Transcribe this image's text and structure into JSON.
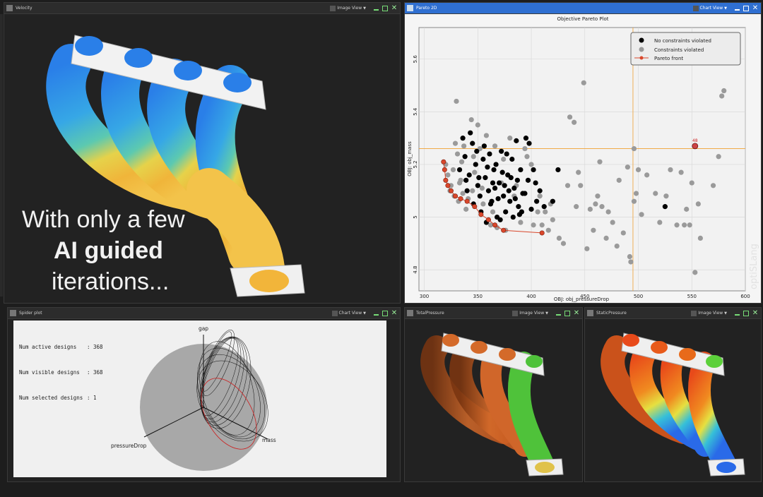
{
  "panels": {
    "velocity": {
      "title": "Velocity",
      "view": "Image View"
    },
    "pareto": {
      "title": "Pareto 2D",
      "view": "Chart View"
    },
    "spider": {
      "title": "Spider plot",
      "view": "Chart View"
    },
    "total_pressure": {
      "title": "TotalPressure",
      "view": "Image View"
    },
    "static_pressure": {
      "title": "StaticPressure",
      "view": "Image View"
    }
  },
  "overlay_text": {
    "line1": "With only a few",
    "line2": "AI guided",
    "line3": "iterations..."
  },
  "spider_info": {
    "active_label": "Num active designs",
    "active_value": ": 368",
    "visible_label": "Num visible designs",
    "visible_value": ": 368",
    "selected_label": "Num selected designs",
    "selected_value": ": 1"
  },
  "spider_axes": {
    "top": "gap",
    "left": "pressureDrop",
    "right": "mass"
  },
  "watermark": "optiSLang",
  "colors": {
    "accent": "#2f6fd1",
    "pareto": "#d9472b",
    "crosshair": "#f0a030"
  },
  "chart_data": {
    "type": "scatter",
    "title": "Objective Pareto Plot",
    "xlabel": "OBJ: obj_pressureDrop",
    "ylabel": "OBJ: obj_mass",
    "xlim": [
      295,
      600
    ],
    "ylim": [
      4.72,
      5.72
    ],
    "xticks": [
      "300",
      "350",
      "400",
      "450",
      "500",
      "550",
      "600"
    ],
    "yticks": [
      "4.8",
      "5",
      "5.2",
      "5.4",
      "5.6"
    ],
    "legend": [
      "No constraints violated",
      "Constraints violated",
      "Pareto front"
    ],
    "legend_position": "top-right",
    "grid": true,
    "crosshair": {
      "x": 495,
      "y": 5.26
    },
    "selected": {
      "x": 553,
      "y": 5.27,
      "label": "48"
    },
    "series": [
      {
        "name": "No constraints violated",
        "values": [
          [
            333,
            5.18
          ],
          [
            338,
            5.23
          ],
          [
            342,
            5.16
          ],
          [
            345,
            5.28
          ],
          [
            348,
            5.2
          ],
          [
            350,
            5.12
          ],
          [
            352,
            5.08
          ],
          [
            355,
            5.22
          ],
          [
            357,
            5.15
          ],
          [
            360,
            5.1
          ],
          [
            362,
            5.05
          ],
          [
            365,
            5.18
          ],
          [
            368,
            5.0
          ],
          [
            370,
            5.13
          ],
          [
            372,
            5.25
          ],
          [
            374,
            5.08
          ],
          [
            376,
            5.02
          ],
          [
            378,
            5.16
          ],
          [
            380,
            5.06
          ],
          [
            382,
            5.22
          ],
          [
            384,
            5.11
          ],
          [
            386,
            5.29
          ],
          [
            388,
            5.04
          ],
          [
            390,
            5.18
          ],
          [
            392,
            5.09
          ],
          [
            395,
            5.3
          ],
          [
            397,
            5.14
          ],
          [
            340,
            5.1
          ],
          [
            346,
            5.05
          ],
          [
            353,
            5.02
          ],
          [
            358,
            4.98
          ],
          [
            363,
            5.06
          ],
          [
            367,
            5.2
          ],
          [
            371,
            4.99
          ],
          [
            375,
            5.12
          ],
          [
            379,
            5.1
          ],
          [
            383,
            5.0
          ],
          [
            387,
            5.14
          ],
          [
            391,
            5.02
          ],
          [
            398,
            5.28
          ],
          [
            402,
            5.18
          ],
          [
            405,
            5.06
          ],
          [
            408,
            5.1
          ],
          [
            412,
            5.04
          ],
          [
            420,
            5.06
          ],
          [
            425,
            5.18
          ],
          [
            525,
            5.04
          ],
          [
            336,
            5.3
          ],
          [
            343,
            5.32
          ],
          [
            349,
            5.25
          ],
          [
            356,
            5.27
          ],
          [
            361,
            5.24
          ],
          [
            366,
            5.11
          ],
          [
            369,
            5.07
          ],
          [
            373,
            5.17
          ],
          [
            377,
            5.24
          ],
          [
            381,
            5.15
          ],
          [
            385,
            5.07
          ],
          [
            389,
            5.01
          ],
          [
            394,
            5.09
          ],
          [
            400,
            5.03
          ],
          [
            404,
            5.13
          ],
          [
            351,
            5.15
          ],
          [
            359,
            5.19
          ],
          [
            364,
            5.13
          ],
          [
            339,
            5.14
          ]
        ]
      },
      {
        "name": "Constraints violated",
        "values": [
          [
            330,
            5.44
          ],
          [
            320,
            5.2
          ],
          [
            322,
            5.16
          ],
          [
            325,
            5.12
          ],
          [
            328,
            5.08
          ],
          [
            331,
            5.24
          ],
          [
            334,
            5.14
          ],
          [
            337,
            5.27
          ],
          [
            341,
            5.07
          ],
          [
            344,
            5.37
          ],
          [
            347,
            5.17
          ],
          [
            354,
            5.11
          ],
          [
            358,
            5.31
          ],
          [
            362,
            4.97
          ],
          [
            366,
            5.27
          ],
          [
            372,
            5.13
          ],
          [
            376,
            4.95
          ],
          [
            380,
            5.3
          ],
          [
            384,
            5.08
          ],
          [
            390,
            4.98
          ],
          [
            396,
            5.23
          ],
          [
            400,
            5.2
          ],
          [
            406,
            5.02
          ],
          [
            410,
            4.97
          ],
          [
            413,
            5.02
          ],
          [
            416,
            4.95
          ],
          [
            420,
            4.99
          ],
          [
            426,
            4.92
          ],
          [
            430,
            4.9
          ],
          [
            434,
            5.12
          ],
          [
            436,
            5.38
          ],
          [
            440,
            5.36
          ],
          [
            444,
            5.17
          ],
          [
            446,
            5.12
          ],
          [
            449,
            5.51
          ],
          [
            452,
            4.88
          ],
          [
            455,
            5.03
          ],
          [
            458,
            4.95
          ],
          [
            460,
            5.05
          ],
          [
            462,
            5.08
          ],
          [
            464,
            5.21
          ],
          [
            466,
            5.04
          ],
          [
            470,
            4.92
          ],
          [
            472,
            5.02
          ],
          [
            476,
            4.98
          ],
          [
            480,
            4.89
          ],
          [
            482,
            5.14
          ],
          [
            486,
            4.94
          ],
          [
            490,
            5.19
          ],
          [
            492,
            4.85
          ],
          [
            493,
            4.83
          ],
          [
            496,
            5.06
          ],
          [
            498,
            5.09
          ],
          [
            500,
            5.18
          ],
          [
            503,
            5.01
          ],
          [
            508,
            5.16
          ],
          [
            516,
            5.09
          ],
          [
            520,
            4.98
          ],
          [
            526,
            5.08
          ],
          [
            530,
            5.18
          ],
          [
            536,
            4.97
          ],
          [
            540,
            5.17
          ],
          [
            543,
            4.97
          ],
          [
            545,
            5.03
          ],
          [
            548,
            4.97
          ],
          [
            550,
            5.13
          ],
          [
            553,
            4.79
          ],
          [
            556,
            5.05
          ],
          [
            558,
            4.92
          ],
          [
            570,
            5.12
          ],
          [
            575,
            5.23
          ],
          [
            578,
            5.46
          ],
          [
            580,
            5.48
          ],
          [
            324,
            5.1
          ],
          [
            327,
            5.18
          ],
          [
            332,
            5.06
          ],
          [
            335,
            5.21
          ],
          [
            339,
            5.03
          ],
          [
            345,
            5.1
          ],
          [
            350,
            5.35
          ],
          [
            355,
            5.05
          ],
          [
            364,
            5.02
          ],
          [
            368,
            4.96
          ],
          [
            374,
            5.22
          ],
          [
            386,
            5.12
          ],
          [
            394,
            5.26
          ],
          [
            402,
            4.97
          ],
          [
            408,
            5.08
          ],
          [
            418,
            5.05
          ],
          [
            442,
            5.04
          ],
          [
            496,
            5.26
          ],
          [
            346,
            5.23
          ],
          [
            333,
            5.13
          ],
          [
            329,
            5.28
          ],
          [
            336,
            5.09
          ],
          [
            352,
            5.26
          ]
        ]
      },
      {
        "name": "Pareto front",
        "values": [
          [
            318,
            5.21
          ],
          [
            319,
            5.18
          ],
          [
            320,
            5.14
          ],
          [
            322,
            5.12
          ],
          [
            325,
            5.1
          ],
          [
            329,
            5.08
          ],
          [
            334,
            5.07
          ],
          [
            340,
            5.06
          ],
          [
            347,
            5.04
          ],
          [
            353,
            5.01
          ],
          [
            360,
            4.99
          ],
          [
            366,
            4.97
          ],
          [
            374,
            4.95
          ],
          [
            410,
            4.94
          ]
        ]
      }
    ]
  }
}
